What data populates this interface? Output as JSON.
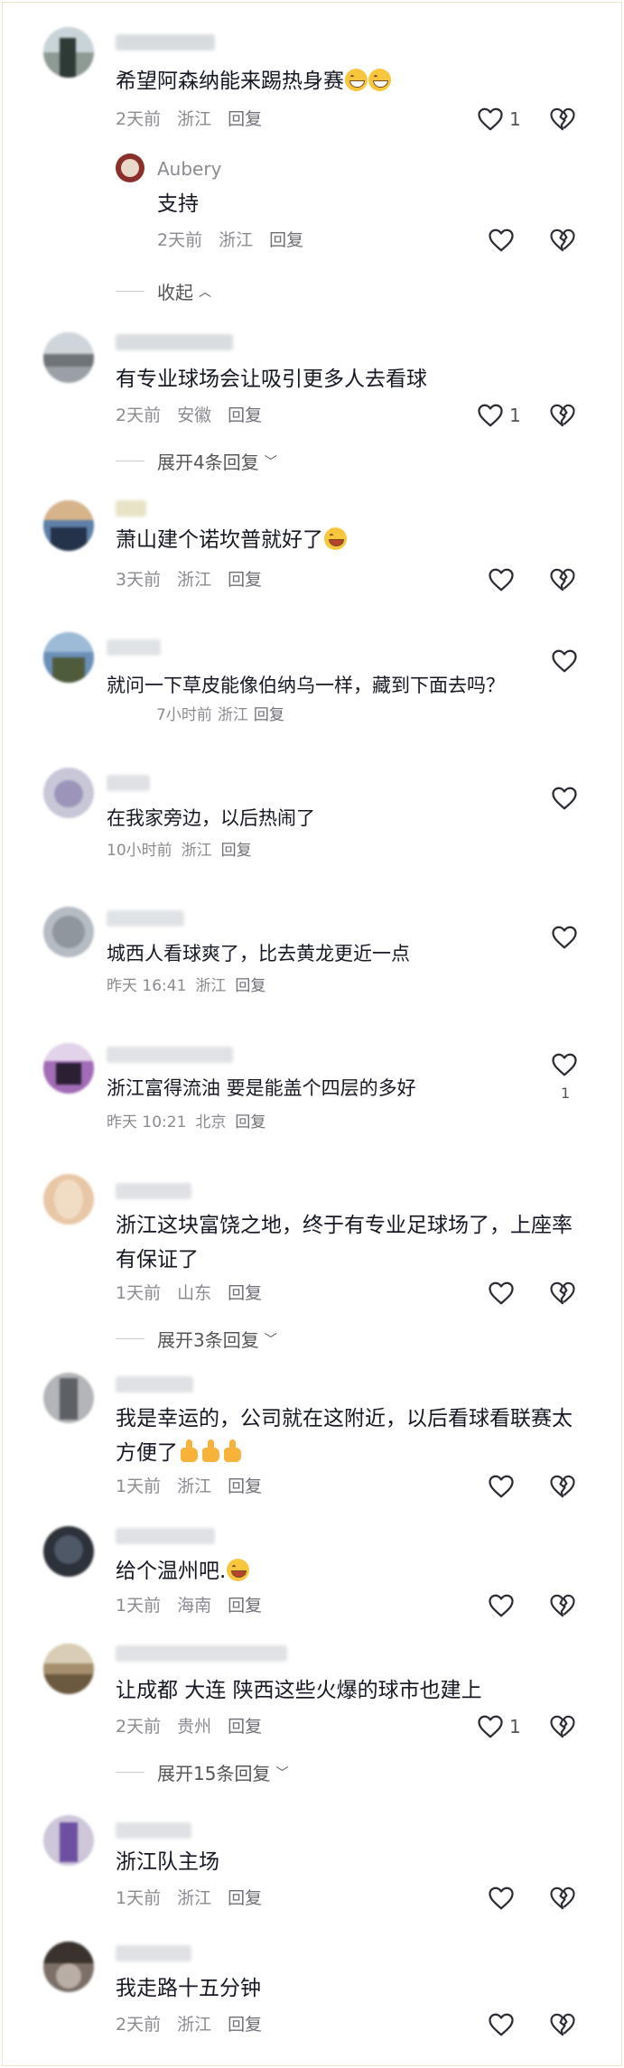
{
  "icons": {
    "like": "heart-outline-icon",
    "dislike": "broken-heart-icon",
    "expand": "chevron-down-icon",
    "collapse": "chevron-up-icon"
  },
  "colors": {
    "text": "#161823",
    "meta": "#8a8b91",
    "border": "#ece4cf"
  },
  "comments": [
    {
      "text": "希望阿森纳能来踢热身赛",
      "time": "2天前",
      "location": "浙江",
      "reply": "回复",
      "likes": "1",
      "emoji": "grin-x2",
      "sub_reply": {
        "username": "Aubery",
        "text": "支持",
        "time": "2天前",
        "location": "浙江",
        "reply": "回复"
      },
      "toggle": "收起"
    },
    {
      "text": "有专业球场会让吸引更多人去看球",
      "time": "2天前",
      "location": "安徽",
      "reply": "回复",
      "likes": "1",
      "toggle": "展开4条回复"
    },
    {
      "text": "萧山建个诺坎普就好了",
      "time": "3天前",
      "location": "浙江",
      "reply": "回复",
      "emoji": "laugh"
    },
    {
      "text": "就问一下草皮能像伯纳乌一样，藏到下面去吗？",
      "time": "7小时前",
      "location": "浙江",
      "reply": "回复"
    },
    {
      "text": "在我家旁边，以后热闹了",
      "time": "10小时前",
      "location": "浙江",
      "reply": "回复"
    },
    {
      "text": "城西人看球爽了，比去黄龙更近一点",
      "time": "昨天 16:41",
      "location": "浙江",
      "reply": "回复"
    },
    {
      "text": "浙江富得流油 要是能盖个四层的多好",
      "time": "昨天 10:21",
      "location": "北京",
      "reply": "回复",
      "likes": "1"
    },
    {
      "text": "浙江这块富饶之地，终于有专业足球场了，上座率有保证了",
      "time": "1天前",
      "location": "山东",
      "reply": "回复",
      "toggle": "展开3条回复"
    },
    {
      "text": "我是幸运的，公司就在这附近，以后看球看联赛太方便了",
      "time": "1天前",
      "location": "浙江",
      "reply": "回复",
      "emoji": "thumbs-x3"
    },
    {
      "text": "给个温州吧.",
      "time": "1天前",
      "location": "海南",
      "reply": "回复",
      "emoji": "laugh"
    },
    {
      "text": "让成都 大连 陕西这些火爆的球市也建上",
      "time": "2天前",
      "location": "贵州",
      "reply": "回复",
      "likes": "1",
      "toggle": "展开15条回复"
    },
    {
      "text": "浙江队主场",
      "time": "1天前",
      "location": "浙江",
      "reply": "回复"
    },
    {
      "text": "我走路十五分钟",
      "time": "2天前",
      "location": "浙江",
      "reply": "回复"
    }
  ]
}
